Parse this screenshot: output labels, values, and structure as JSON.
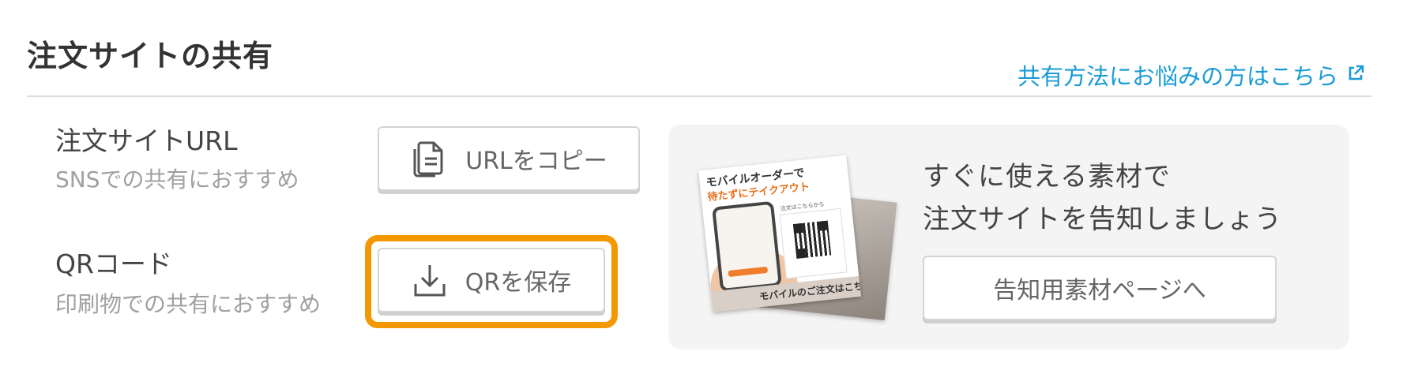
{
  "section": {
    "title": "注文サイトの共有",
    "help_link": "共有方法にお悩みの方はこちら",
    "help_icon": "external-link-icon"
  },
  "url_row": {
    "label": "注文サイトURL",
    "sub": "SNSでの共有におすすめ",
    "button_label": "URLをコピー",
    "button_icon": "copy-document-icon"
  },
  "qr_row": {
    "label": "QRコード",
    "sub": "印刷物での共有におすすめ",
    "button_label": "QRを保存",
    "button_icon": "download-icon",
    "highlight_color": "#f39800"
  },
  "promo": {
    "line1": "すぐに使える素材で",
    "line2": "注文サイトを告知しましょう",
    "button_label": "告知用素材ページへ",
    "thumbnail": {
      "title": "モバイルオーダーで",
      "subtitle": "待たずにテイクアウト",
      "qr_label": "注文はこちらから",
      "footer": "モバイルのご注文はこちら"
    }
  },
  "colors": {
    "link": "#1a9bd6",
    "accent": "#f39800",
    "panel_bg": "#f4f4f4"
  }
}
